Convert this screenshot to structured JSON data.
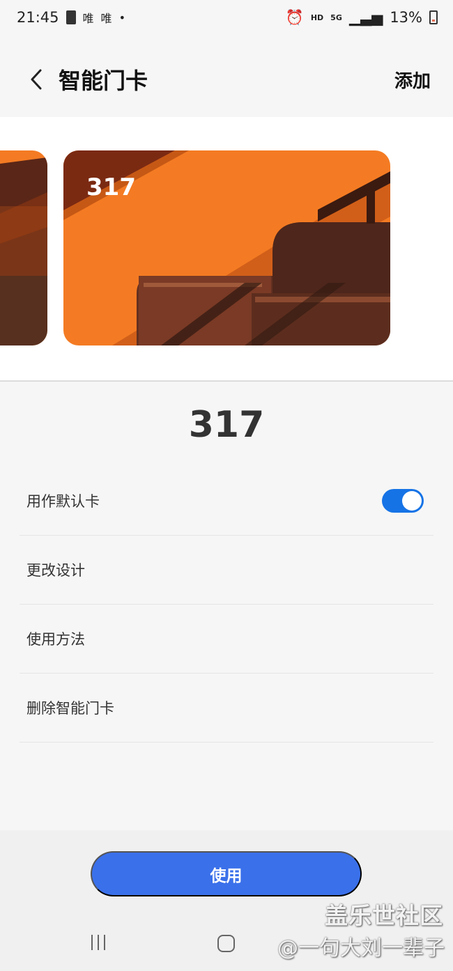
{
  "status": {
    "time": "21:45",
    "carrier_1": "唯",
    "carrier_2": "唯",
    "dot": "•",
    "hd": "HD",
    "network": "5G",
    "battery": "13%"
  },
  "header": {
    "title": "智能门卡",
    "add_label": "添加"
  },
  "cards": {
    "main_number": "317"
  },
  "card_detail": {
    "name": "317"
  },
  "settings": {
    "items": [
      {
        "label": "用作默认卡",
        "toggle": true
      },
      {
        "label": "更改设计"
      },
      {
        "label": "使用方法"
      },
      {
        "label": "删除智能门卡"
      }
    ]
  },
  "actions": {
    "use_label": "使用"
  },
  "watermark": {
    "site": "盖乐世社区",
    "user": "@一句大刘一辈子"
  },
  "colors": {
    "accent": "#3a70ea",
    "toggle": "#1673e6",
    "card_orange": "#f47b23"
  }
}
